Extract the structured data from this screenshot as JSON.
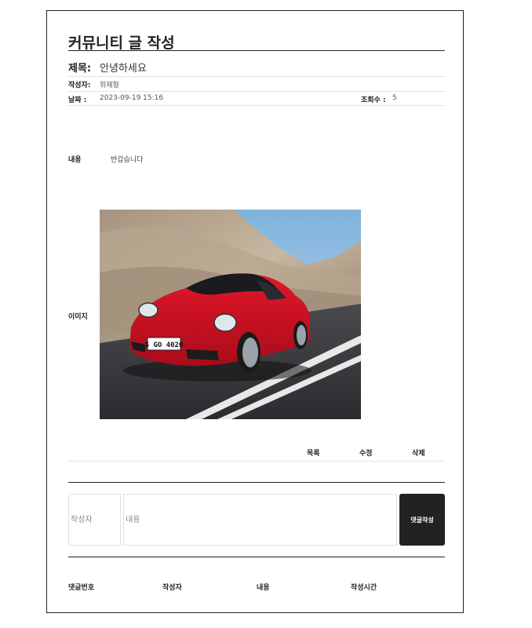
{
  "page": {
    "title": "커뮤니티 글 작성"
  },
  "post": {
    "subject_label": "제목:",
    "subject": "안녕하세요",
    "author_label": "작성자:",
    "author": "위재형",
    "date_label": "날짜 :",
    "date": "2023-09-19 15:16",
    "views_label": "조회수 :",
    "views": "5",
    "content_label": "내용",
    "content": "반갑습니다",
    "image_label": "이미지",
    "image_icon": "red-sports-car-photo"
  },
  "actions": {
    "list": "목록",
    "edit": "수정",
    "delete": "삭제"
  },
  "comment_form": {
    "author_placeholder": "작성자",
    "content_placeholder": "내용",
    "submit_label": "댓글작성"
  },
  "comments_table": {
    "headers": [
      "댓글번호",
      "작성자",
      "내용",
      "작성시간"
    ]
  },
  "colors": {
    "border": "#222222",
    "button": "#222222",
    "rule_light": "#e3e3e3"
  }
}
